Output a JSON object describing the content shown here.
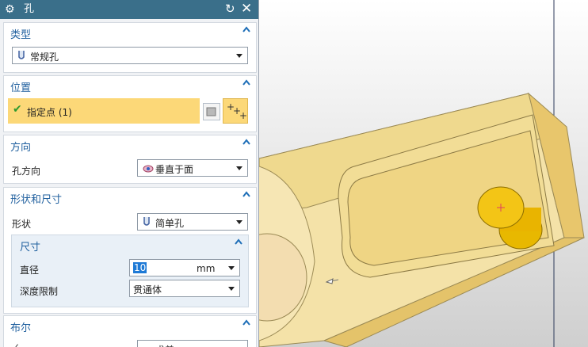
{
  "dialog": {
    "title": "孔",
    "sections": {
      "type": {
        "header": "类型",
        "value": "常规孔"
      },
      "position": {
        "header": "位置",
        "specify_point": "指定点 (1)"
      },
      "direction": {
        "header": "方向",
        "label": "孔方向",
        "value": "垂直于面"
      },
      "shape": {
        "header": "形状和尺寸",
        "label": "形状",
        "value": "简单孔",
        "dimensions": {
          "header": "尺寸",
          "diameter_label": "直径",
          "diameter_value": "10",
          "diameter_unit": "mm",
          "depth_label": "深度限制",
          "depth_value": "贯通体"
        }
      },
      "boolean": {
        "header": "布尔",
        "value": "求差"
      }
    }
  },
  "icons": {
    "settings": "gear-icon",
    "reset": "reset-icon",
    "close": "close-icon",
    "check": "checkmark-icon",
    "collapse": "chevron-up-icon"
  }
}
